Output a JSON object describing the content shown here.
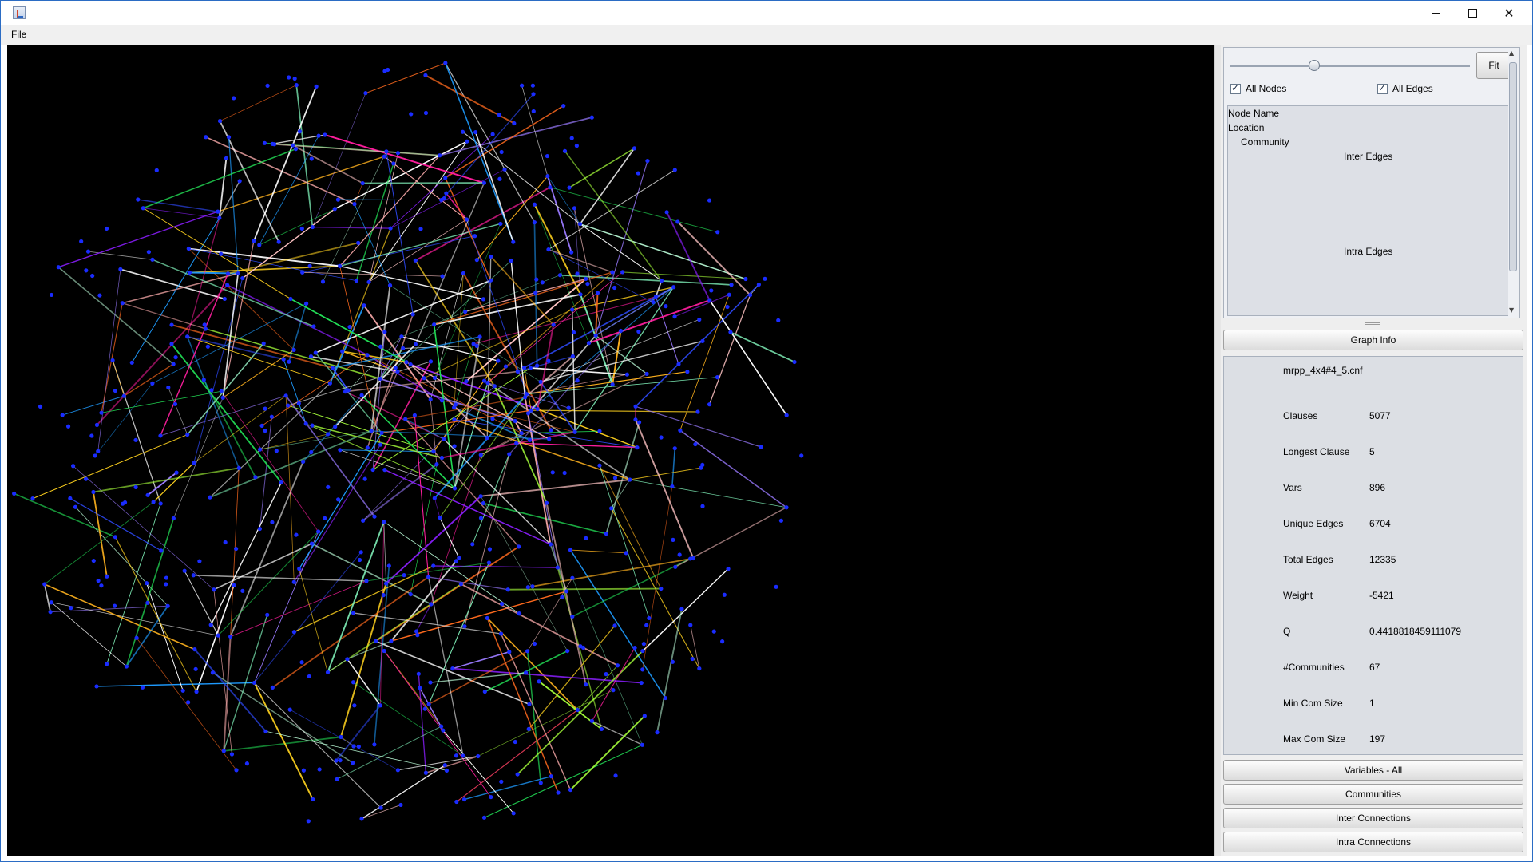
{
  "window": {
    "menu": [
      "File"
    ],
    "controls": {
      "minimize": "—",
      "maximize": "☐",
      "close": "✕"
    }
  },
  "sidebar": {
    "fit_label": "Fit",
    "zoom_slider": 0.35,
    "checkboxes": [
      {
        "label": "All Nodes",
        "checked": true
      },
      {
        "label": "All Edges",
        "checked": true
      }
    ],
    "node_info": {
      "node_name": "Node Name",
      "location": "Location",
      "community": "Community",
      "inter_edges": "Inter Edges",
      "intra_edges": "Intra Edges"
    },
    "graph_info_button": "Graph Info",
    "graph_info": {
      "filename": "mrpp_4x4#4_5.cnf",
      "stats": [
        {
          "label": "Clauses",
          "value": "5077"
        },
        {
          "label": "Longest Clause",
          "value": "5"
        },
        {
          "label": "Vars",
          "value": "896"
        },
        {
          "label": "Unique Edges",
          "value": "6704"
        },
        {
          "label": "Total Edges",
          "value": "12335"
        },
        {
          "label": "Weight",
          "value": "-5421"
        },
        {
          "label": "Q",
          "value": "0.4418818459111079"
        },
        {
          "label": "#Communities",
          "value": "67"
        },
        {
          "label": "Min Com Size",
          "value": "1"
        },
        {
          "label": "Max Com Size",
          "value": "197"
        }
      ]
    },
    "buttons": [
      "Variables - All",
      "Communities",
      "Inter Connections",
      "Intra Connections"
    ]
  },
  "graph": {
    "node_color": "#1a2cff",
    "edge_colors": [
      "#ffffff",
      "#ffc4c4",
      "#f4a6a6",
      "#b6f5d2",
      "#7ff0b8",
      "#ffffff",
      "#ff1e9e",
      "#2f4bff",
      "#ffd21e",
      "#ffb21e",
      "#a6ff3a",
      "#22dd55",
      "#9a7aff",
      "#8b1eff",
      "#ff6a1e",
      "#1e9bff",
      "#ffffff"
    ]
  }
}
